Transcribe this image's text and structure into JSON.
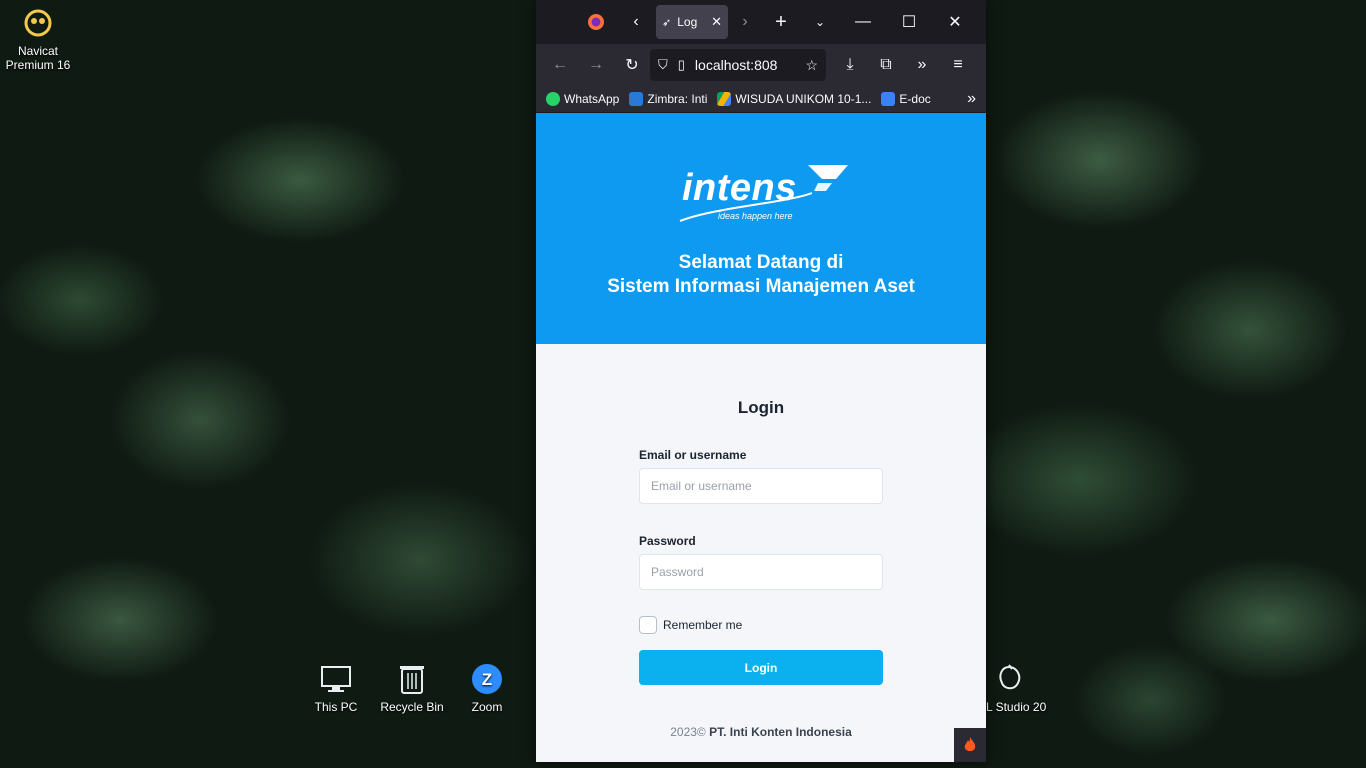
{
  "desktop": {
    "icons": [
      {
        "label": "Navicat Premium 16"
      },
      {
        "label": "This PC"
      },
      {
        "label": "Recycle Bin"
      },
      {
        "label": "Zoom"
      },
      {
        "label": "L Studio 20"
      }
    ]
  },
  "browser": {
    "tab_title": "Log",
    "url": "localhost:808",
    "bookmarks": [
      {
        "label": "WhatsApp",
        "color": "#25d366"
      },
      {
        "label": "Zimbra: Inti",
        "color": "#2a7ad5"
      },
      {
        "label": "WISUDA UNIKOM 10-1...",
        "color": "#f4b400"
      },
      {
        "label": "E-doc",
        "color": "#3b82f6"
      }
    ]
  },
  "page": {
    "brand": "intens",
    "tagline": "ideas happen here",
    "welcome_line1": "Selamat Datang di",
    "welcome_line2": "Sistem Informasi Manajemen Aset",
    "login_title": "Login",
    "email_label": "Email or username",
    "email_placeholder": "Email or username",
    "password_label": "Password",
    "password_placeholder": "Password",
    "remember_label": "Remember me",
    "login_button": "Login",
    "footer_year": "2023©",
    "footer_company": "PT. Inti Konten Indonesia",
    "header_color": "#0d9af0",
    "button_color": "#0bb0ef"
  }
}
